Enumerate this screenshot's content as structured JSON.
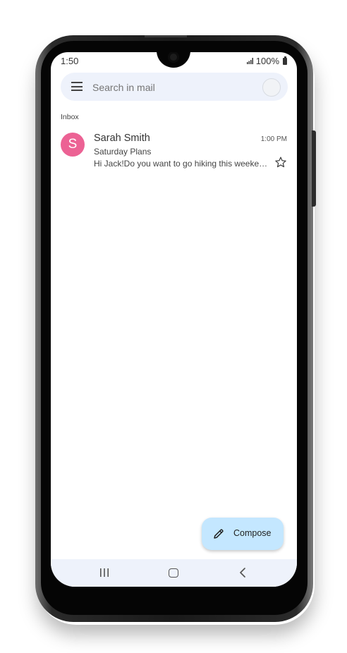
{
  "status_bar": {
    "time": "1:50",
    "battery": "100%"
  },
  "search": {
    "placeholder": "Search in mail"
  },
  "mailbox": {
    "label": "Inbox"
  },
  "emails": [
    {
      "avatar_letter": "S",
      "avatar_color": "#ec6294",
      "sender": "Sarah Smith",
      "time": "1:00 PM",
      "subject": "Saturday Plans",
      "snippet": "Hi Jack!Do you want to go hiking this weekend?"
    }
  ],
  "compose": {
    "label": "Compose",
    "color": "#c4e7ff"
  },
  "icons": {
    "menu": "hamburger-menu-icon",
    "star": "star-outline-icon",
    "compose": "pencil-icon",
    "nav_recent": "recent-apps-icon",
    "nav_home": "home-icon",
    "nav_back": "back-icon"
  }
}
